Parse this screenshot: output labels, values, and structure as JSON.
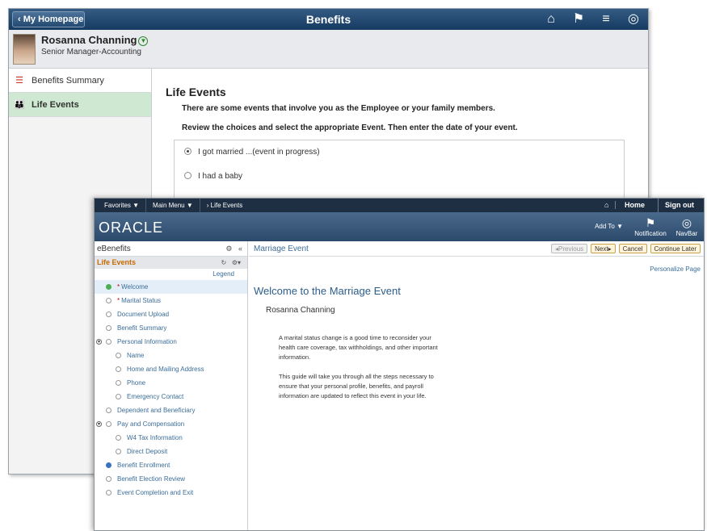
{
  "back": {
    "home_button": "My Homepage",
    "title": "Benefits",
    "header_icons": [
      "home-icon",
      "flag-icon",
      "menu-icon",
      "compass-icon"
    ],
    "profile": {
      "name": "Rosanna Channing",
      "title": "Senior Manager-Accounting"
    },
    "sidenav": [
      {
        "label": "Benefits Summary",
        "active": false
      },
      {
        "label": "Life Events",
        "active": true
      }
    ],
    "content": {
      "heading": "Life Events",
      "intro1": "There are some events that involve you as the Employee or your family members.",
      "intro2": "Review the choices and select the appropriate Event. Then enter the date of your event.",
      "choices": [
        {
          "label": "I got married ...(event in progress)",
          "selected": true
        },
        {
          "label": "I had a baby",
          "selected": false
        }
      ]
    }
  },
  "front": {
    "topbar": {
      "favorites": "Favorites ▼",
      "main_menu": "Main Menu ▼",
      "breadcrumb": "› Life Events",
      "home": "Home",
      "signout": "Sign out"
    },
    "brand": "ORACLE",
    "add_to": "Add To ▼",
    "notification": "Notification",
    "navbar": "NavBar",
    "left": {
      "header": "eBenefits",
      "section": "Life Events",
      "legend": "Legend",
      "steps": [
        {
          "label": "Welcome",
          "required": true,
          "status": "done",
          "indent": 0,
          "current": true
        },
        {
          "label": "Marital Status",
          "required": true,
          "status": "open",
          "indent": 0
        },
        {
          "label": "Document Upload",
          "status": "open",
          "indent": 0
        },
        {
          "label": "Benefit Summary",
          "status": "open",
          "indent": 0
        },
        {
          "label": "Personal Information",
          "status": "open",
          "indent": 0,
          "expander": true
        },
        {
          "label": "Name",
          "status": "open",
          "indent": 1
        },
        {
          "label": "Home and Mailing Address",
          "status": "open",
          "indent": 1
        },
        {
          "label": "Phone",
          "status": "open",
          "indent": 1
        },
        {
          "label": "Emergency Contact",
          "status": "open",
          "indent": 1
        },
        {
          "label": "Dependent and Beneficiary",
          "status": "open",
          "indent": 0
        },
        {
          "label": "Pay and Compensation",
          "status": "open",
          "indent": 0,
          "expander": true
        },
        {
          "label": "W4 Tax Information",
          "status": "open",
          "indent": 1
        },
        {
          "label": "Direct Deposit",
          "status": "open",
          "indent": 1
        },
        {
          "label": "Benefit Enrollment",
          "status": "info",
          "indent": 0
        },
        {
          "label": "Benefit Election Review",
          "status": "open",
          "indent": 0
        },
        {
          "label": "Event Completion and Exit",
          "status": "open",
          "indent": 0
        }
      ]
    },
    "right": {
      "header": "Marriage Event",
      "buttons": {
        "previous": "◂Previous",
        "next": "Next▸",
        "cancel": "Cancel",
        "later": "Continue Later"
      },
      "personalize": "Personalize Page",
      "welcome": "Welcome to the Marriage Event",
      "name": "Rosanna Channing",
      "para1": "A marital status change is a good time to reconsider your health care coverage, tax withholdings, and other important information.",
      "para2": "This guide will take you through all the steps necessary to ensure that your personal profile, benefits, and payroll information are updated to reflect this event in your life."
    }
  }
}
